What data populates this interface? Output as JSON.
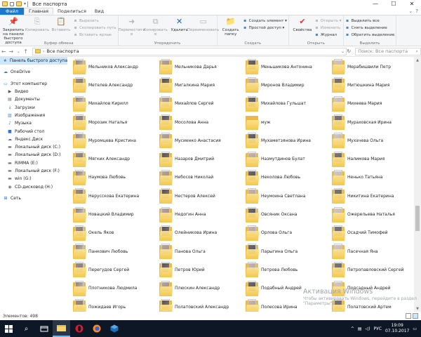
{
  "window": {
    "title": "Все паспорта"
  },
  "tabs": [
    "Файл",
    "Главная",
    "Поделиться",
    "Вид"
  ],
  "ribbon": {
    "groups": [
      {
        "label": "Буфер обмена",
        "big": [
          {
            "label": "Закрепить на панели быстрого доступа",
            "icon": "pin-icon",
            "dim": false
          },
          {
            "label": "Копировать",
            "icon": "copy-icon",
            "dim": true
          },
          {
            "label": "Вставить",
            "icon": "paste-icon",
            "dim": true
          }
        ],
        "small": [
          "Вырезать",
          "Скопировать путь",
          "Вставить ярлык"
        ]
      },
      {
        "label": "Упорядочить",
        "big": [
          {
            "label": "Переместить в",
            "icon": "move-to-icon",
            "dim": true
          },
          {
            "label": "Копировать в",
            "icon": "copy-to-icon",
            "dim": true
          },
          {
            "label": "Удалить",
            "icon": "delete-icon",
            "dim": false
          },
          {
            "label": "Переименовать",
            "icon": "rename-icon",
            "dim": true
          }
        ],
        "small": []
      },
      {
        "label": "Создать",
        "big": [
          {
            "label": "Создать папку",
            "icon": "new-folder-icon",
            "dim": false
          }
        ],
        "small": [
          "Создать элемент ▾",
          "Простой доступ ▾"
        ]
      },
      {
        "label": "Открыть",
        "big": [
          {
            "label": "Свойства",
            "icon": "properties-icon",
            "dim": false
          }
        ],
        "small": [
          "Открыть ▾",
          "Изменить",
          "Журнал"
        ]
      },
      {
        "label": "Выделить",
        "big": [],
        "small": [
          "Выделить все",
          "Снять выделение",
          "Обратить выделение"
        ]
      }
    ]
  },
  "address": {
    "path": "Все паспорта",
    "search_placeholder": "Поиск: Все паспорта"
  },
  "nav": [
    {
      "label": "Панель быстрого доступа",
      "icon": "star-icon",
      "level": 0,
      "selected": true
    },
    {
      "gap": true
    },
    {
      "label": "OneDrive",
      "icon": "cloud-icon",
      "level": 0
    },
    {
      "gap": true
    },
    {
      "label": "Этот компьютер",
      "icon": "computer-icon",
      "level": 0
    },
    {
      "label": "Видео",
      "icon": "video-icon",
      "level": 1
    },
    {
      "label": "Документы",
      "icon": "documents-icon",
      "level": 1
    },
    {
      "label": "Загрузки",
      "icon": "downloads-icon",
      "level": 1
    },
    {
      "label": "Изображения",
      "icon": "pictures-icon",
      "level": 1
    },
    {
      "label": "Музыка",
      "icon": "music-icon",
      "level": 1
    },
    {
      "label": "Рабочий стол",
      "icon": "desktop-icon",
      "level": 1
    },
    {
      "label": "Яндекс.Диск",
      "icon": "cloud-icon",
      "level": 1
    },
    {
      "label": "Локальный диск (C:)",
      "icon": "drive-icon",
      "level": 1
    },
    {
      "label": "Локальный диск (D:)",
      "icon": "drive-icon",
      "level": 1
    },
    {
      "label": "RIMMA (E:)",
      "icon": "drive-icon",
      "level": 1
    },
    {
      "label": "Локальный диск (F:)",
      "icon": "drive-icon",
      "level": 1
    },
    {
      "label": "win (G:)",
      "icon": "drive-icon",
      "level": 1
    },
    {
      "label": "CD-дисковод (H:)",
      "icon": "cd-drive-icon",
      "level": 1
    },
    {
      "gap": true
    },
    {
      "label": "Сеть",
      "icon": "network-icon",
      "level": 0
    }
  ],
  "folders": [
    "Мельников Александр",
    "Мельникова Дарья",
    "Меньшикова Антонина",
    "Мерабишвили Петр",
    "Метелев Александр",
    "Мигалкина Мария",
    "Миронов Владимир",
    "Митюшкина Мария",
    "Михайлов Кирилл",
    "Михайлов Сергей",
    "Михайлова Гульшат",
    "Михеева Мария",
    "Морозик Наталья",
    "Мосолова Анна",
    "муж",
    "Мураховская Ирина",
    "Муромцева Кристина",
    "Мусиенко Анастасия",
    "Мухаметзянова Ирина",
    "Мухачева Ольга",
    "Мягких Александр",
    "Назаров Дмитрий",
    "Назмутдинов Булат",
    "Налимова Мария",
    "Наумова Любовь",
    "Небосов Николай",
    "Неколова Любовь",
    "Ненько Татьяна",
    "Нерусскова Екатерина",
    "Нестеров Алексей",
    "Неумоина Светлана",
    "Никитина Екатерина",
    "Новацкий Владимир",
    "Недогин Анна",
    "Овсяник Оксана",
    "Ожерельева Наталья",
    "Окель Яков",
    "Олейникова Ирина",
    "Орлова Ольга",
    "Осадчий Тимофей",
    "Панкович Любовь",
    "Панова Ольга",
    "Парыгина Ольга",
    "Пасечная Яна",
    "Перегудов Сергей",
    "Петров Юрий",
    "Петрова Любовь",
    "Петропавловский Сергей",
    "Плотникова Людмила",
    "Плюскин Александр",
    "Подабный Андрей",
    "Подсадный Андрей",
    "Пожидаев Игорь",
    "Полатовский Александр",
    "Полесова Ирина",
    "Полатовский Артем"
  ],
  "watermark": {
    "title": "Активация Windows",
    "text": "Чтобы активировать Windows, перейдите в раздел \"Параметры\"."
  },
  "status": {
    "count": "Элементов: 498"
  },
  "taskbar": {
    "lang": "РУС",
    "time": "19:09",
    "date": "07.10.2017"
  },
  "colors": {
    "accent": "#1979ca",
    "taskbar": "#0e1725",
    "folder": "#f4c94e",
    "selection": "#cce8ff"
  }
}
